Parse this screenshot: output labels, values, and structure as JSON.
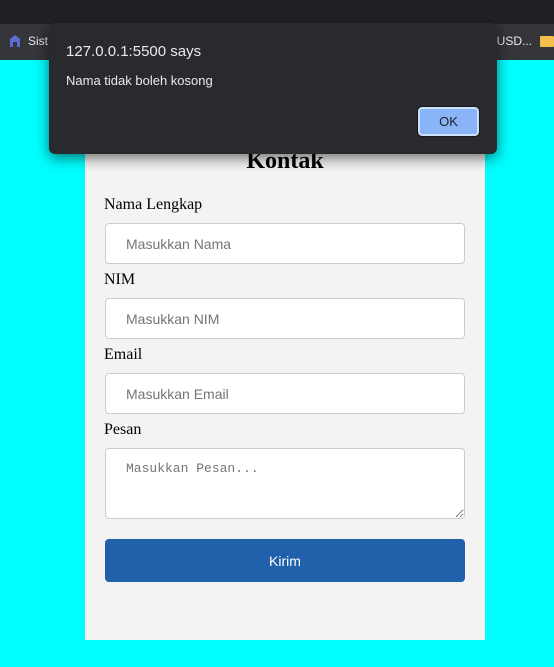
{
  "browser": {
    "bookmark_left": "Sist",
    "bookmark_right": "CUSD..."
  },
  "dialog": {
    "title": "127.0.0.1:5500 says",
    "message": "Nama tidak boleh kosong",
    "ok_label": "OK"
  },
  "form": {
    "title": "Kontak",
    "name_label": "Nama Lengkap",
    "name_placeholder": "Masukkan Nama",
    "nim_label": "NIM",
    "nim_placeholder": "Masukkan NIM",
    "email_label": "Email",
    "email_placeholder": "Masukkan Email",
    "message_label": "Pesan",
    "message_placeholder": "Masukkan Pesan...",
    "submit_label": "Kirim"
  },
  "colors": {
    "page_background": "#00ffff",
    "card_background": "#f3f3f3",
    "submit_button": "#2160aa",
    "dialog_background": "#292a2d",
    "ok_button": "#8ab4f8"
  },
  "icons": {
    "bookmark_left": "site-favicon-icon",
    "bookmark_right": "folder-icon"
  }
}
